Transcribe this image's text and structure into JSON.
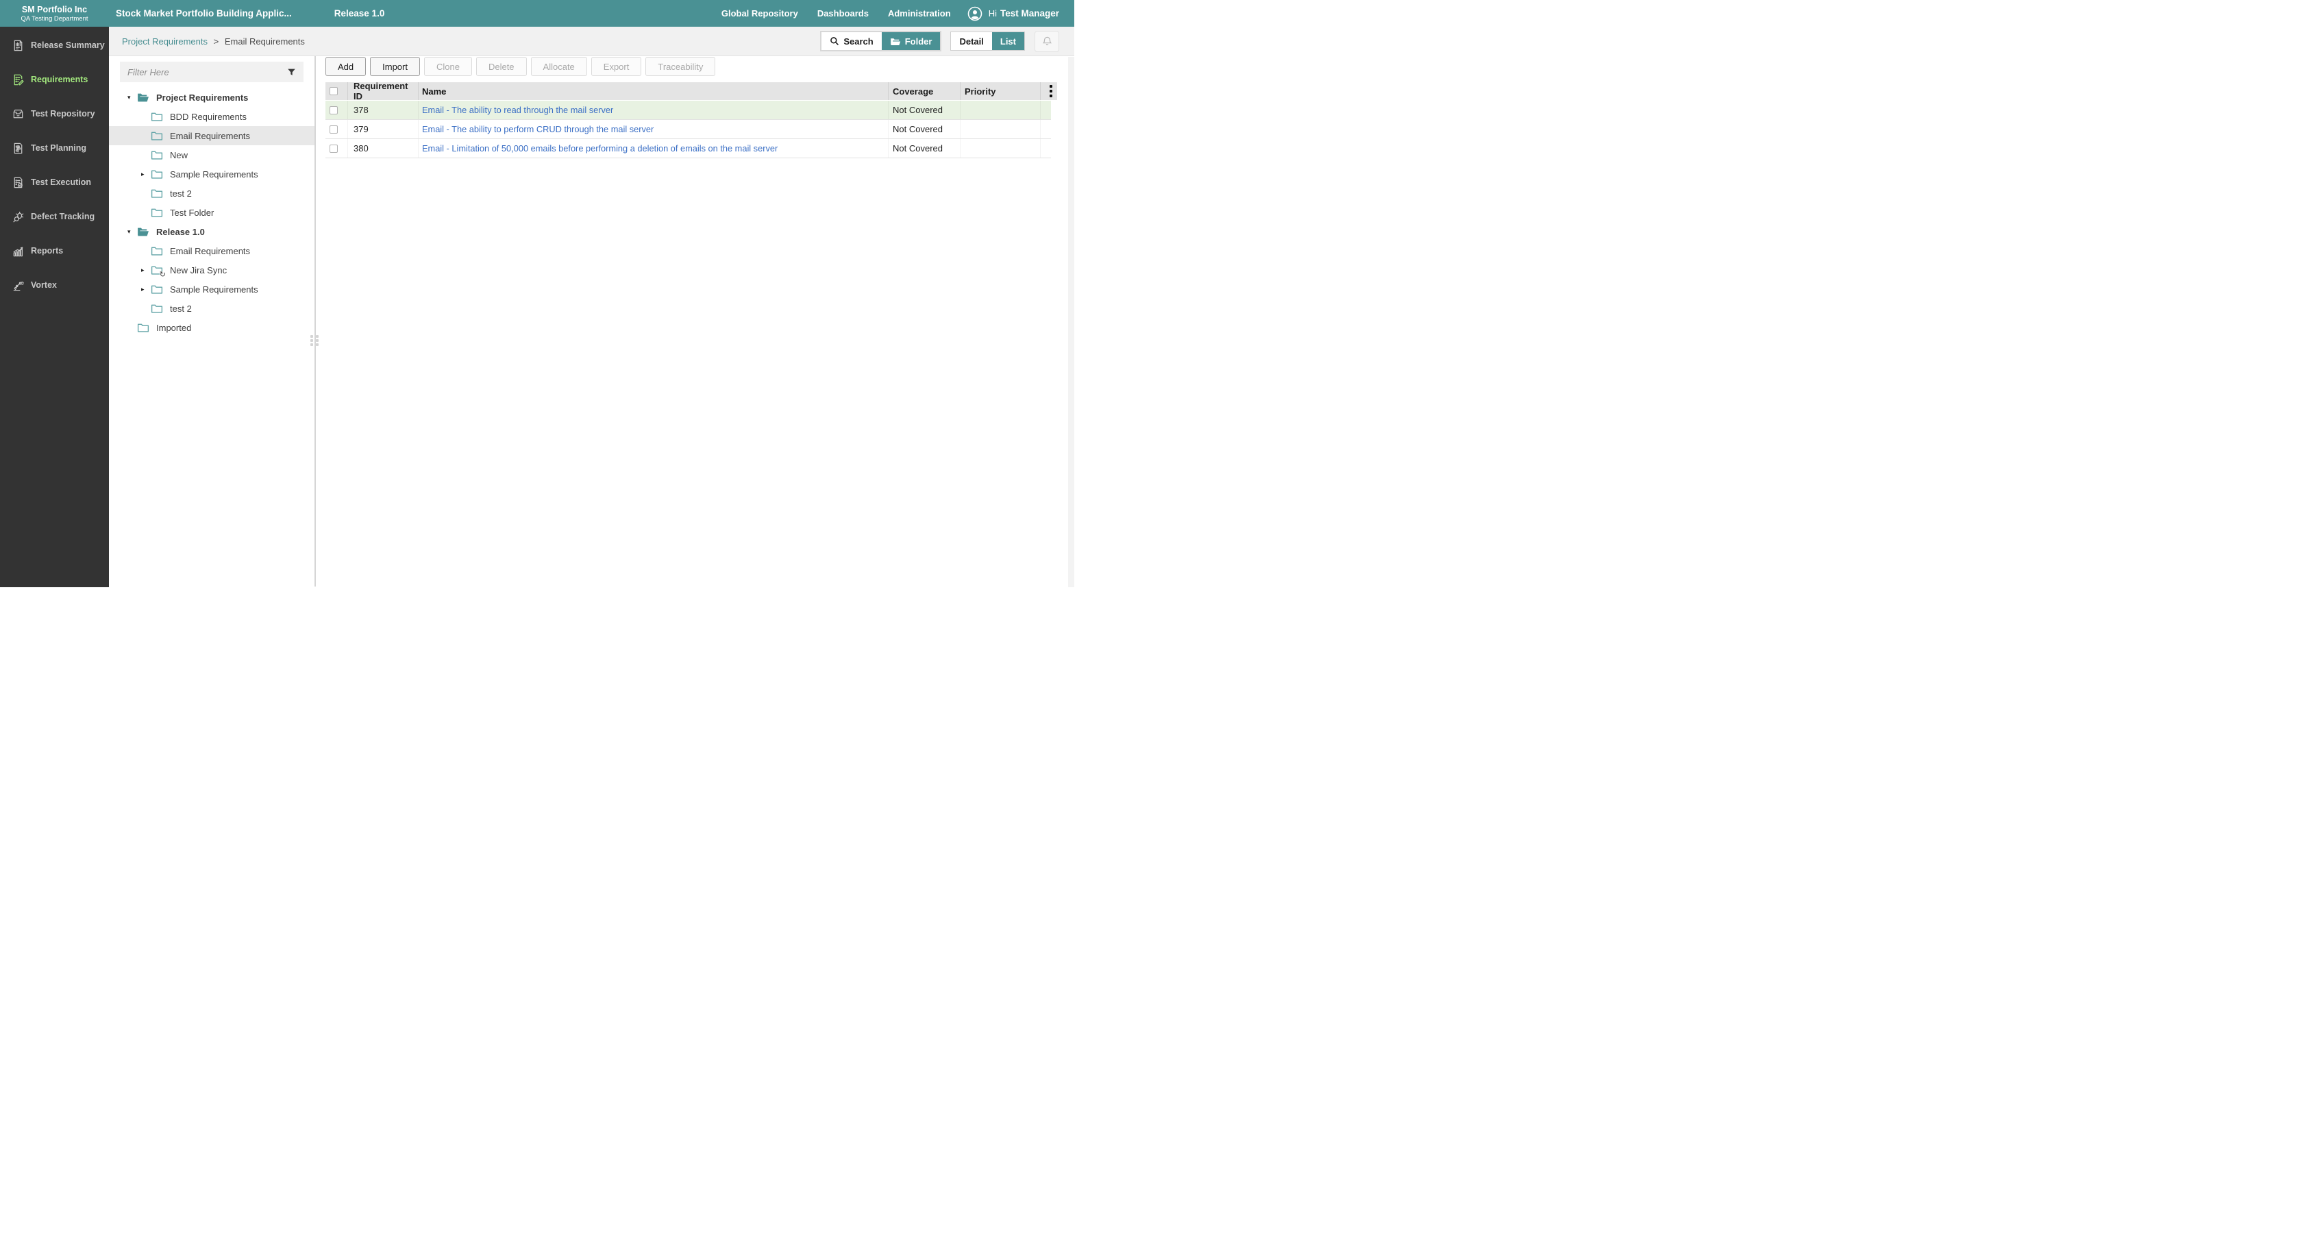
{
  "colors": {
    "accent_teal": "#4A9194",
    "sidebar_bg": "#333333",
    "active_item_green": "#A3E87E",
    "row_highlight_green": "#E8F2E2",
    "link_blue": "#3B6FC5"
  },
  "header": {
    "org": "SM Portfolio Inc",
    "dept": "QA Testing Department",
    "project": "Stock Market Portfolio Building Applic...",
    "release": "Release 1.0",
    "nav": [
      {
        "label": "Global Repository"
      },
      {
        "label": "Dashboards"
      },
      {
        "label": "Administration"
      }
    ],
    "greeting": "Hi",
    "user": "Test Manager"
  },
  "sidebar": {
    "items": [
      {
        "label": "Release Summary",
        "icon": "release-summary-icon",
        "active": false
      },
      {
        "label": "Requirements",
        "icon": "requirements-icon",
        "active": true
      },
      {
        "label": "Test Repository",
        "icon": "test-repository-icon",
        "active": false
      },
      {
        "label": "Test Planning",
        "icon": "test-planning-icon",
        "active": false
      },
      {
        "label": "Test Execution",
        "icon": "test-execution-icon",
        "active": false
      },
      {
        "label": "Defect Tracking",
        "icon": "defect-tracking-icon",
        "active": false
      },
      {
        "label": "Reports",
        "icon": "reports-icon",
        "active": false
      },
      {
        "label": "Vortex",
        "icon": "vortex-icon",
        "active": false
      }
    ]
  },
  "breadcrumb": {
    "parent": "Project Requirements",
    "separator": ">",
    "current": "Email Requirements"
  },
  "view_controls": {
    "search_label": "Search",
    "folder_label": "Folder",
    "detail_label": "Detail",
    "list_label": "List",
    "active_left": "Folder",
    "active_right": "List"
  },
  "tree": {
    "filter_placeholder": "Filter Here",
    "nodes": [
      {
        "label": "Project Requirements",
        "level": 0,
        "arrow": "down",
        "folder": "open",
        "bold": true,
        "selected": false
      },
      {
        "label": "BDD Requirements",
        "level": 1,
        "arrow": "",
        "folder": "closed",
        "bold": false,
        "selected": false
      },
      {
        "label": "Email Requirements",
        "level": 1,
        "arrow": "",
        "folder": "closed",
        "bold": false,
        "selected": true
      },
      {
        "label": "New",
        "level": 1,
        "arrow": "",
        "folder": "closed",
        "bold": false,
        "selected": false
      },
      {
        "label": "Sample Requirements",
        "level": 1,
        "arrow": "right",
        "folder": "closed",
        "bold": false,
        "selected": false
      },
      {
        "label": "test 2",
        "level": 1,
        "arrow": "",
        "folder": "closed",
        "bold": false,
        "selected": false
      },
      {
        "label": "Test Folder",
        "level": 1,
        "arrow": "",
        "folder": "closed",
        "bold": false,
        "selected": false
      },
      {
        "label": "Release 1.0",
        "level": 0,
        "arrow": "down",
        "folder": "open",
        "bold": true,
        "selected": false
      },
      {
        "label": "Email Requirements",
        "level": 1,
        "arrow": "",
        "folder": "closed",
        "bold": false,
        "selected": false
      },
      {
        "label": "New Jira Sync",
        "level": 1,
        "arrow": "right",
        "folder": "sync",
        "bold": false,
        "selected": false
      },
      {
        "label": "Sample Requirements",
        "level": 1,
        "arrow": "right",
        "folder": "closed",
        "bold": false,
        "selected": false
      },
      {
        "label": "test 2",
        "level": 1,
        "arrow": "",
        "folder": "closed",
        "bold": false,
        "selected": false
      },
      {
        "label": "Imported",
        "level": 0,
        "arrow": "",
        "folder": "closed",
        "bold": false,
        "selected": false
      }
    ]
  },
  "toolbar": {
    "buttons": [
      {
        "label": "Add",
        "enabled": true
      },
      {
        "label": "Import",
        "enabled": true
      },
      {
        "label": "Clone",
        "enabled": false
      },
      {
        "label": "Delete",
        "enabled": false
      },
      {
        "label": "Allocate",
        "enabled": false
      },
      {
        "label": "Export",
        "enabled": false
      },
      {
        "label": "Traceability",
        "enabled": false
      }
    ]
  },
  "table": {
    "columns": {
      "id": "Requirement ID",
      "name": "Name",
      "coverage": "Coverage",
      "priority": "Priority"
    },
    "rows": [
      {
        "id": "378",
        "name": "Email - The ability to read through the mail server",
        "coverage": "Not Covered",
        "priority": "",
        "highlighted": true
      },
      {
        "id": "379",
        "name": "Email - The ability to perform CRUD through the mail server",
        "coverage": "Not Covered",
        "priority": "",
        "highlighted": false
      },
      {
        "id": "380",
        "name": "Email - Limitation of 50,000 emails before performing a deletion of emails on the mail server",
        "coverage": "Not Covered",
        "priority": "",
        "highlighted": false
      }
    ]
  }
}
